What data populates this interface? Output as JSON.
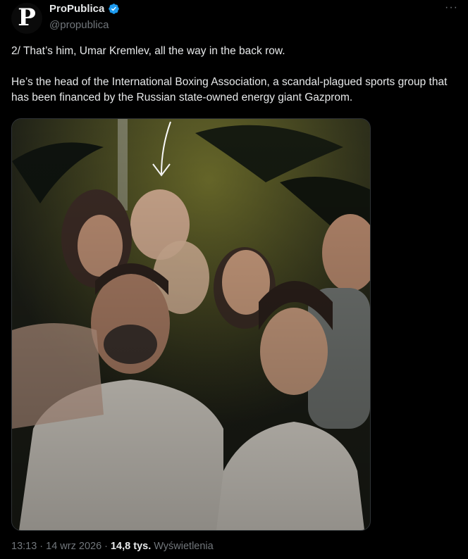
{
  "account": {
    "avatar_letter": "P",
    "display_name": "ProPublica",
    "handle": "@propublica",
    "verified": true
  },
  "more_label": "···",
  "tweet": {
    "text": "2/ That’s him, Umar Kremlev, all the way in the back row.\n\nHe’s the head of the International Boxing Association, a scandal-plagued sports group that has been financed by the Russian state-owned energy giant Gazprom."
  },
  "meta": {
    "time": "13:13",
    "sep1": "·",
    "date": "14 wrz 2026",
    "sep2": "·",
    "views_count": "14,8 tys.",
    "views_label": "Wyświetlenia"
  },
  "colors": {
    "background": "#000000",
    "text": "#e7e9ea",
    "secondary": "#71767b",
    "verified_blue": "#1d9bf0"
  }
}
